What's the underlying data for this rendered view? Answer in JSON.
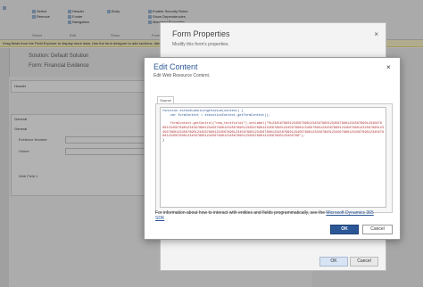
{
  "ribbon": {
    "items": [
      "Select",
      "Remove",
      "Header",
      "Footer",
      "Navigation",
      "Enable Security Roles",
      "Show Dependencies",
      "Managed Properties",
      "Body"
    ],
    "groups": [
      "Select",
      "Edit",
      "Show",
      "Form"
    ]
  },
  "infobar": {
    "text": "Drag fields from the Field Explorer to display more data. Use the form designer to add sections, tabs and fields for the form."
  },
  "breadcrumb": {
    "solution": "Solution: Default Solution",
    "form": "Form: Financial Evidence"
  },
  "form_canvas": {
    "header_label": "Header",
    "general_label": "General",
    "general_sub": "General",
    "field1": "Evidence Number",
    "field2": "Owner",
    "field3": "Web Field 1"
  },
  "form_properties": {
    "title": "Form Properties",
    "subtitle": "Modify this form's properties.",
    "close": "×",
    "ok": "OK",
    "cancel": "Cancel"
  },
  "edit_content": {
    "title": "Edit Content",
    "subtitle": "Edit Web Resource Content.",
    "close": "×",
    "tab_source": "Source",
    "code_line1": "function extendLabelLengthissue(context) {",
    "code_line2": "    var formContext = executionContext.getFormContext();",
    "code_line3": "    formContext.getControl(\"new_textfield1\").setLabel(\"012345678901234567890123456789012345678901234567890123456789012345678901234567890123456789012345678901234567890123456789012345678901234567890123456789012345678901234567890123456789012345678901234567890123456789012345678901234567890123456789012345678901234567890123456789012345678901234567890123456789012345678901234567890123456789012345678901234567890123456789\");",
    "code_line4": "}",
    "info": "For information about how to interact with entities and fields programmatically, see the",
    "info_link": "Microsoft Dynamics 365 SDK",
    "ok": "OK",
    "cancel": "Cancel"
  }
}
